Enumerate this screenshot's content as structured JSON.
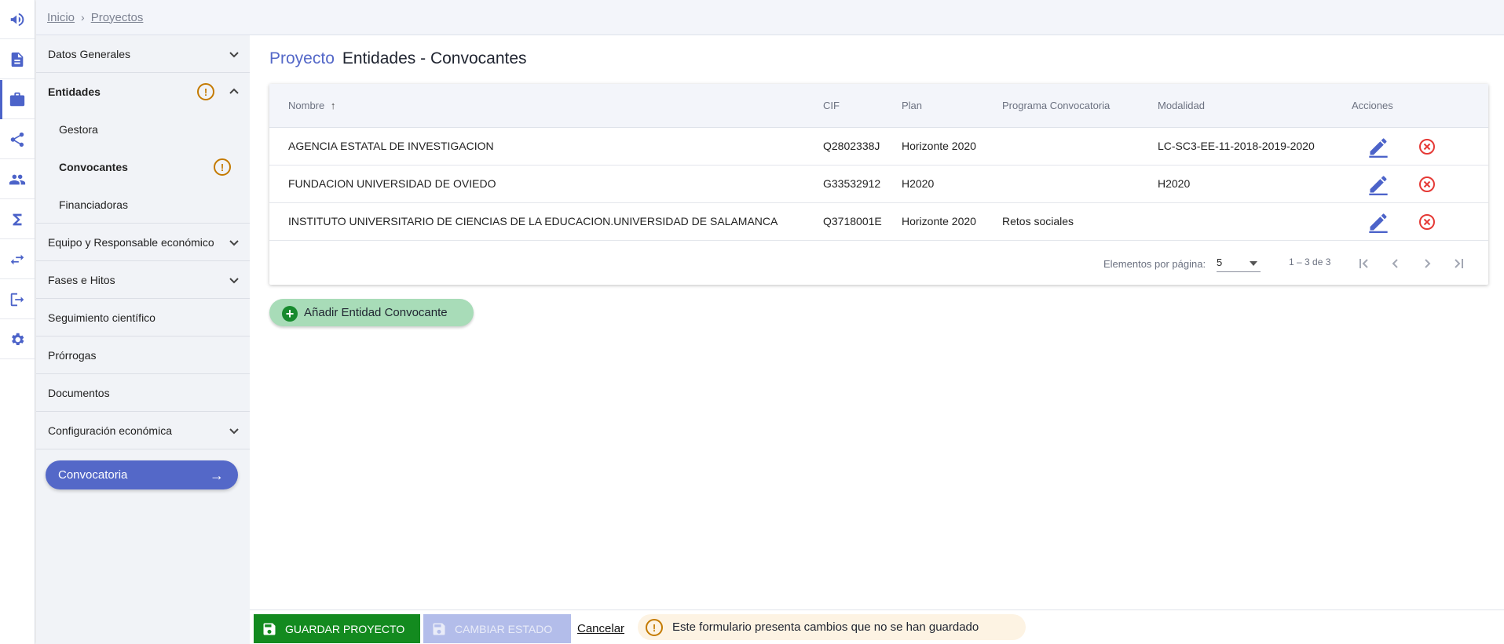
{
  "breadcrumb": {
    "items": [
      "Inicio",
      "Proyectos"
    ]
  },
  "rail": {
    "icons": [
      "megaphone-icon",
      "document-icon",
      "briefcase-icon",
      "share-icon",
      "people-icon",
      "sigma-icon",
      "transfer-icon",
      "logout-icon",
      "settings-icon"
    ]
  },
  "sidebar": {
    "items": [
      {
        "label": "Datos Generales"
      },
      {
        "label": "Entidades"
      },
      {
        "label": "Gestora"
      },
      {
        "label": "Convocantes"
      },
      {
        "label": "Financiadoras"
      },
      {
        "label": "Equipo y Responsable económico"
      },
      {
        "label": "Fases e Hitos"
      },
      {
        "label": "Seguimiento científico"
      },
      {
        "label": "Prórrogas"
      },
      {
        "label": "Documentos"
      },
      {
        "label": "Configuración económica"
      }
    ],
    "convocatoria_button": "Convocatoria",
    "warning_symbol": "!"
  },
  "page": {
    "crumb": "Proyecto",
    "title": "Entidades - Convocantes"
  },
  "table": {
    "headers": {
      "nombre": "Nombre",
      "cif": "CIF",
      "plan": "Plan",
      "programa": "Programa Convocatoria",
      "modalidad": "Modalidad",
      "acciones": "Acciones"
    },
    "sort_icon": "arrow-up-icon",
    "rows": [
      {
        "nombre": "AGENCIA ESTATAL DE INVESTIGACION",
        "cif": "Q2802338J",
        "plan": "Horizonte 2020",
        "programa": "",
        "modalidad": "LC-SC3-EE-11-2018-2019-2020"
      },
      {
        "nombre": "FUNDACION UNIVERSIDAD DE OVIEDO",
        "cif": "G33532912",
        "plan": "H2020",
        "programa": "",
        "modalidad": "H2020"
      },
      {
        "nombre": "INSTITUTO UNIVERSITARIO DE CIENCIAS DE LA EDUCACION.UNIVERSIDAD DE SALAMANCA",
        "cif": "Q3718001E",
        "plan": "Horizonte 2020",
        "programa": "Retos sociales",
        "modalidad": ""
      }
    ]
  },
  "paginator": {
    "label": "Elementos por página:",
    "page_size": "5",
    "range": "1 – 3 de 3"
  },
  "add_button": {
    "label": "Añadir Entidad Convocante",
    "symbol": "+"
  },
  "footer": {
    "save_label": "GUARDAR PROYECTO",
    "state_label": "CAMBIAR ESTADO",
    "cancel_label": "Cancelar",
    "unsaved_message": "Este formulario presenta cambios que no se han guardado",
    "warning_symbol": "!"
  },
  "colors": {
    "accent": "#5468c8",
    "save": "#138a1f",
    "warning": "#c47a00",
    "delete": "#e53935"
  }
}
